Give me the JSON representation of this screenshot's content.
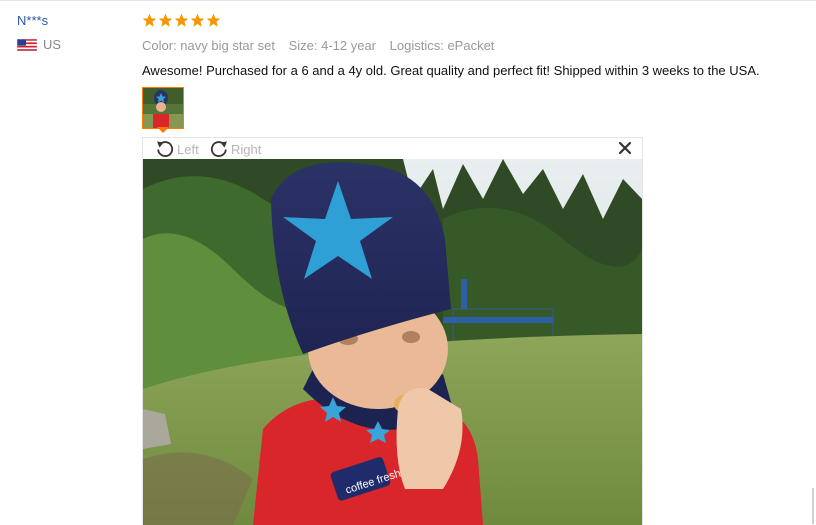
{
  "reviewer": {
    "name": "N***s",
    "country": "US",
    "flag_icon": "us-flag-icon"
  },
  "review": {
    "rating_stars": 5,
    "rating_max": 5,
    "star_color": "#f39800",
    "color": "Color: navy big star set",
    "size": "Size: 4-12 year",
    "logistics": "Logistics: ePacket",
    "comment": "Awesome! Purchased for a 6 and a 4y old. Great quality and perfect fit! Shipped within 3 weeks to the USA."
  },
  "viewer": {
    "rotate_left_label": "Left",
    "rotate_right_label": "Right",
    "rotate_left_icon": "rotate-left-icon",
    "rotate_right_icon": "rotate-right-icon",
    "close_icon": "close-icon",
    "shirt_logo_text": "coffee fresh",
    "thumb_accent_color": "#ff7a00"
  }
}
